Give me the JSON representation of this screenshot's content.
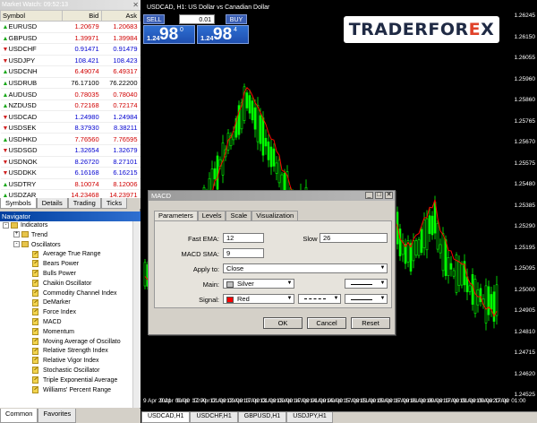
{
  "market_watch": {
    "title": "Market Watch: 09:52:13",
    "headers": {
      "symbol": "Symbol",
      "bid": "Bid",
      "ask": "Ask"
    },
    "rows": [
      {
        "symbol": "EURUSD",
        "bid": "1.20679",
        "ask": "1.20683",
        "dir": "up",
        "bid_color": "#d00000",
        "ask_color": "#d00000"
      },
      {
        "symbol": "GBPUSD",
        "bid": "1.39971",
        "ask": "1.39984",
        "dir": "up",
        "bid_color": "#d00000",
        "ask_color": "#d00000"
      },
      {
        "symbol": "USDCHF",
        "bid": "0.91471",
        "ask": "0.91479",
        "dir": "down",
        "bid_color": "#0000d0",
        "ask_color": "#0000d0"
      },
      {
        "symbol": "USDJPY",
        "bid": "108.421",
        "ask": "108.423",
        "dir": "down",
        "bid_color": "#0000d0",
        "ask_color": "#0000d0"
      },
      {
        "symbol": "USDCNH",
        "bid": "6.49074",
        "ask": "6.49317",
        "dir": "up",
        "bid_color": "#d00000",
        "ask_color": "#d00000"
      },
      {
        "symbol": "USDRUB",
        "bid": "76.17100",
        "ask": "76.22200",
        "dir": "up",
        "bid_color": "#000000",
        "ask_color": "#000000"
      },
      {
        "symbol": "AUDUSD",
        "bid": "0.78035",
        "ask": "0.78040",
        "dir": "up",
        "bid_color": "#d00000",
        "ask_color": "#d00000"
      },
      {
        "symbol": "NZDUSD",
        "bid": "0.72168",
        "ask": "0.72174",
        "dir": "up",
        "bid_color": "#d00000",
        "ask_color": "#d00000"
      },
      {
        "symbol": "USDCAD",
        "bid": "1.24980",
        "ask": "1.24984",
        "dir": "down",
        "bid_color": "#0000d0",
        "ask_color": "#0000d0"
      },
      {
        "symbol": "USDSEK",
        "bid": "8.37930",
        "ask": "8.38211",
        "dir": "down",
        "bid_color": "#0000d0",
        "ask_color": "#0000d0"
      },
      {
        "symbol": "USDHKD",
        "bid": "7.76560",
        "ask": "7.76595",
        "dir": "up",
        "bid_color": "#d00000",
        "ask_color": "#d00000"
      },
      {
        "symbol": "USDSGD",
        "bid": "1.32654",
        "ask": "1.32679",
        "dir": "down",
        "bid_color": "#0000d0",
        "ask_color": "#0000d0"
      },
      {
        "symbol": "USDNOK",
        "bid": "8.26720",
        "ask": "8.27101",
        "dir": "down",
        "bid_color": "#0000d0",
        "ask_color": "#0000d0"
      },
      {
        "symbol": "USDDKK",
        "bid": "6.16168",
        "ask": "6.16215",
        "dir": "down",
        "bid_color": "#0000d0",
        "ask_color": "#0000d0"
      },
      {
        "symbol": "USDTRY",
        "bid": "8.10074",
        "ask": "8.12006",
        "dir": "up",
        "bid_color": "#d00000",
        "ask_color": "#d00000"
      },
      {
        "symbol": "USDZAR",
        "bid": "14.23468",
        "ask": "14.23971",
        "dir": "up",
        "bid_color": "#d00000",
        "ask_color": "#d00000"
      }
    ],
    "tabs": [
      "Symbols",
      "Details",
      "Trading",
      "Ticks"
    ]
  },
  "navigator": {
    "title": "Navigator",
    "groups": [
      {
        "label": "Indicators",
        "level": 0,
        "expander": "-",
        "icon": "folder-icon"
      },
      {
        "label": "Trend",
        "level": 1,
        "expander": "+",
        "icon": "folder-icon"
      },
      {
        "label": "Oscillators",
        "level": 1,
        "expander": "-",
        "icon": "folder-icon"
      }
    ],
    "items": [
      "Average True Range",
      "Bears Power",
      "Bulls Power",
      "Chaikin Oscillator",
      "Commodity Channel Index",
      "DeMarker",
      "Force Index",
      "MACD",
      "Momentum",
      "Moving Average of Oscillato",
      "Relative Strength Index",
      "Relative Vigor Index",
      "Stochastic Oscillator",
      "Triple Exponential Average",
      "Williams' Percent Range"
    ],
    "tabs": [
      "Common",
      "Favorites"
    ]
  },
  "chart": {
    "title": "USDCAD, H1:  US Dollar vs Canadian Dollar",
    "trade": {
      "sell": "SELL",
      "buy": "BUY",
      "lot": "0.01",
      "sell_small": "1.24",
      "sell_big": "98",
      "sell_sup": "0",
      "buy_small": "1.24",
      "buy_big": "98",
      "buy_sup": "4"
    },
    "logo": {
      "part1": "TRADERFOR",
      "x": "E",
      "part2": "X"
    },
    "price_ticks": [
      "1.26245",
      "1.26150",
      "1.26055",
      "1.25960",
      "1.25860",
      "1.25765",
      "1.25670",
      "1.25575",
      "1.25480",
      "1.25385",
      "1.25290",
      "1.25195",
      "1.25095",
      "1.25000",
      "1.24905",
      "1.24810",
      "1.24715",
      "1.24620",
      "1.24525"
    ],
    "time_ticks": [
      "9 Apr 2021",
      "9 Apr 09:00",
      "9 Apr 17:00",
      "12 Apr 01:00",
      "12 Apr 09:00",
      "12 Apr 17:00",
      "13 Apr 01:00",
      "13 Apr 09:00",
      "13 Apr 17:00",
      "14 Apr 01:00",
      "14 Apr 09:00",
      "14 Apr 17:00",
      "15 Apr 01:00",
      "15 Apr 09:00",
      "15 Apr 17:00",
      "16 Apr 01:00",
      "16 Apr 09:00",
      "16 Apr 17:00",
      "19 Apr 01:00",
      "19 Apr 09:00",
      "19 Apr 17:00",
      "20 Apr 01:00"
    ],
    "tabs": [
      "USDCAD,H1",
      "USDCHF,H1",
      "GBPUSD,H1",
      "USDJPY,H1"
    ],
    "colors": {
      "candle": "#00ff00",
      "signal": "#ff0000"
    }
  },
  "dialog": {
    "title": "MACD",
    "tabs": [
      "Parameters",
      "Levels",
      "Scale",
      "Visualization"
    ],
    "fast_ema_label": "Fast EMA:",
    "fast_ema": "12",
    "slow_ema_label": "Slow EMA:",
    "slow_ema": "26",
    "macd_sma_label": "MACD SMA:",
    "macd_sma": "9",
    "apply_label": "Apply to:",
    "apply": "Close",
    "main_label": "Main:",
    "main_color_name": "Silver",
    "main_color": "#c0c0c0",
    "signal_label": "Signal:",
    "signal_color_name": "Red",
    "signal_color": "#ff0000",
    "ok": "OK",
    "cancel": "Cancel",
    "reset": "Reset"
  }
}
